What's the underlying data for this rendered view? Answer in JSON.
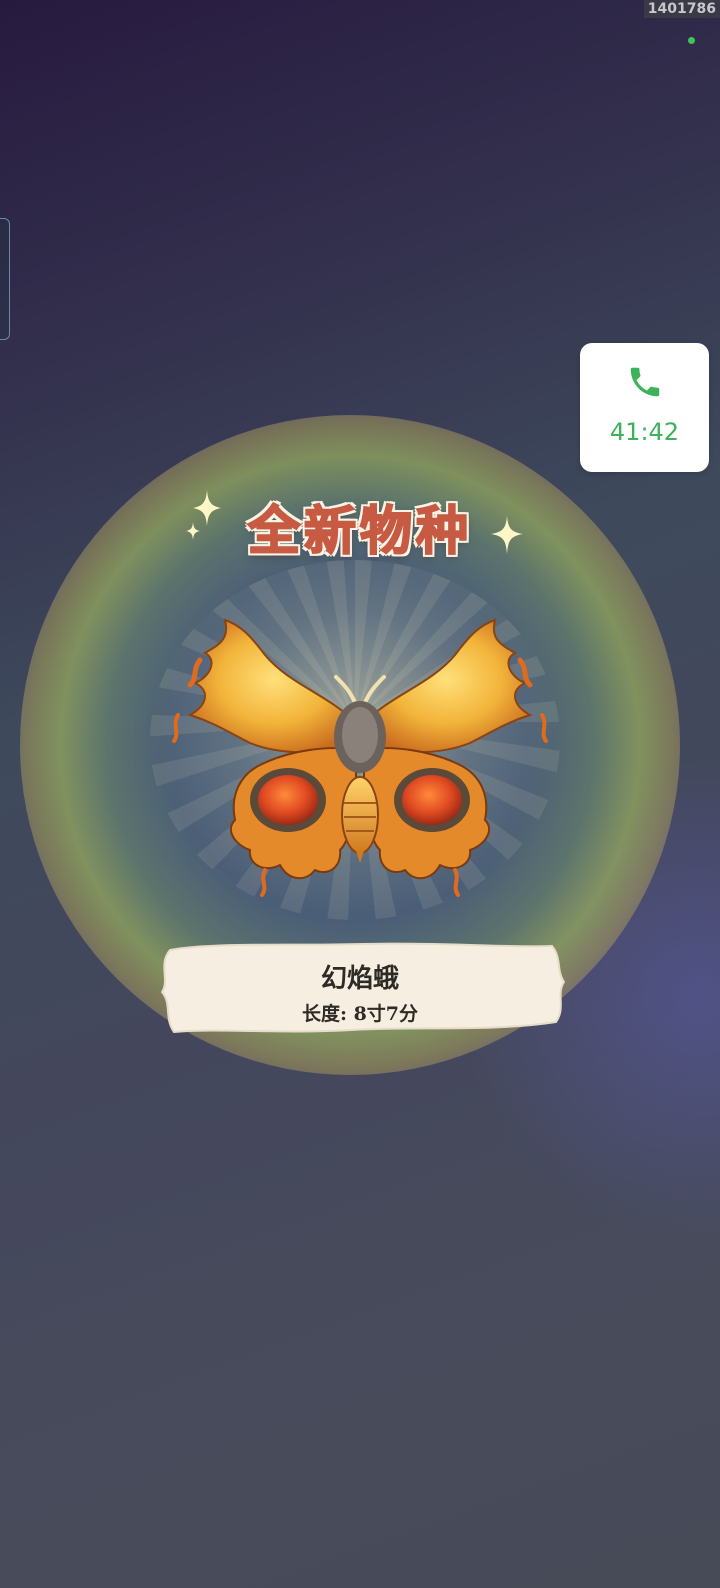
{
  "status_bar": {
    "corner_code": "1401786"
  },
  "call_widget": {
    "icon": "phone-icon",
    "elapsed": "41:42"
  },
  "reveal": {
    "banner_title": "全新物种",
    "creature_icon": "fire-moth-illustration",
    "creature_name": "幻焰蛾",
    "length_text": "长度: 8寸7分"
  },
  "colors": {
    "title_red": "#c65a42",
    "call_green": "#3db25a",
    "card_cream": "#f6efe1"
  }
}
